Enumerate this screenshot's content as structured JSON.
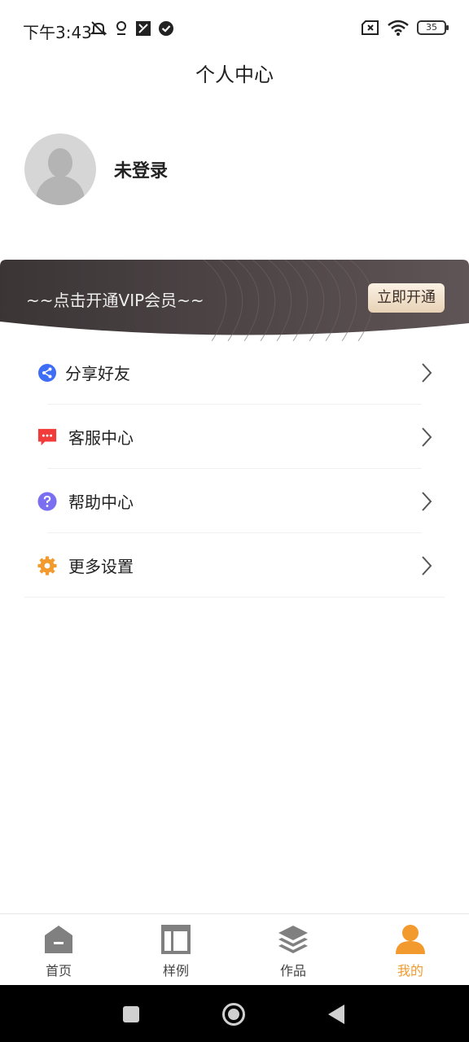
{
  "status_bar": {
    "time": "下午3:43",
    "battery": "35",
    "icons_left": [
      "mute-icon",
      "location-icon",
      "nfc-icon",
      "check-circle-icon"
    ],
    "icons_right": [
      "no-sim-icon",
      "wifi-icon",
      "battery-icon"
    ]
  },
  "header": {
    "title": "个人中心"
  },
  "profile": {
    "name": "未登录",
    "avatar_icon": "default-avatar-icon"
  },
  "vip": {
    "text": "~~点击开通VIP会员~~",
    "button": "立即开通",
    "gradient": [
      "#3b3536",
      "#5f5456"
    ]
  },
  "menu": {
    "items": [
      {
        "label": "分享好友",
        "icon": "share-icon",
        "color": "#3d6ef5"
      },
      {
        "label": "客服中心",
        "icon": "chat-icon",
        "color": "#f23c3c"
      },
      {
        "label": "帮助中心",
        "icon": "help-icon",
        "color": "#7a6ff0"
      },
      {
        "label": "更多设置",
        "icon": "gear-icon",
        "color": "#f29a2e"
      }
    ]
  },
  "tabs": [
    {
      "label": "首页",
      "icon": "home-icon",
      "active": false
    },
    {
      "label": "样例",
      "icon": "template-icon",
      "active": false
    },
    {
      "label": "作品",
      "icon": "layers-icon",
      "active": false
    },
    {
      "label": "我的",
      "icon": "user-icon",
      "active": true
    }
  ],
  "colors": {
    "accent": "#f29a2e",
    "tab_inactive": "#808080"
  },
  "nav": {
    "buttons": [
      "recent-apps-icon",
      "home-circle-icon",
      "back-icon"
    ]
  }
}
